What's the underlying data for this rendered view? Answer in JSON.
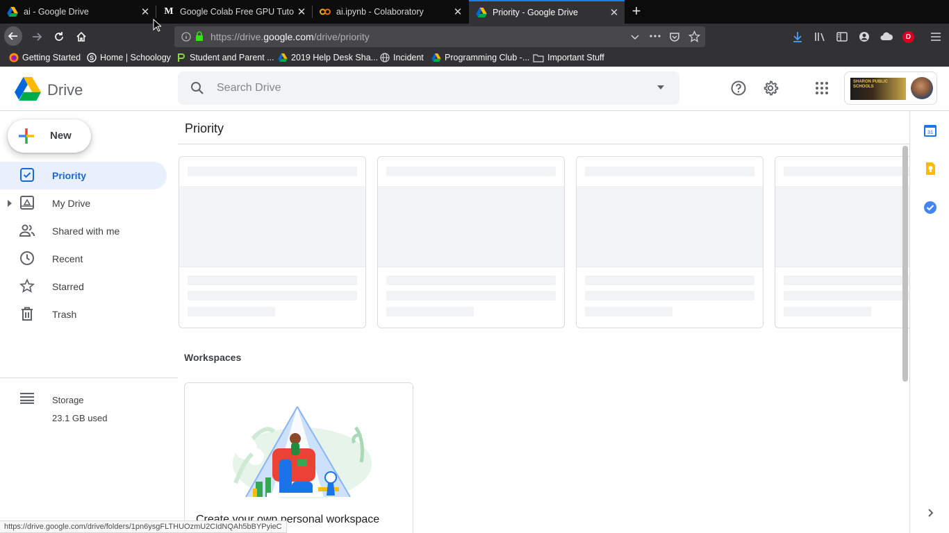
{
  "browser": {
    "tabs": [
      {
        "title": "ai - Google Drive",
        "favicon": "google-drive-icon"
      },
      {
        "title": "Google Colab Free GPU Tutoria",
        "favicon": "medium-icon"
      },
      {
        "title": "ai.ipynb - Colaboratory",
        "favicon": "colab-icon"
      },
      {
        "title": "Priority - Google Drive",
        "favicon": "google-drive-icon",
        "active": true
      }
    ],
    "close_glyph": "✕",
    "newtab_glyph": "+",
    "url": {
      "prefix": "https://drive.",
      "domain": "google.com",
      "path": "/drive/priority"
    },
    "profile_initial": "D",
    "bookmarks": [
      {
        "label": "Getting Started",
        "icon": "firefox-icon"
      },
      {
        "label": "Home | Schoology",
        "icon": "schoology-icon"
      },
      {
        "label": "Student and Parent ...",
        "icon": "bookmark-p-icon"
      },
      {
        "label": "2019 Help Desk Sha...",
        "icon": "google-drive-icon"
      },
      {
        "label": "Incident",
        "icon": "globe-icon"
      },
      {
        "label": "Programming Club -...",
        "icon": "google-drive-icon"
      },
      {
        "label": "Important Stuff",
        "icon": "folder-icon"
      }
    ],
    "status_url": "https://drive.google.com/drive/folders/1pn6ysgFLTHUOzmU2CIdNQAh5bBYPyieC"
  },
  "app": {
    "name": "Drive",
    "search_placeholder": "Search Drive",
    "account_logo_text": "SHARON PUBLIC SCHOOLS",
    "new_label": "New",
    "nav": [
      {
        "label": "Priority",
        "icon": "priority-check-icon",
        "active": true
      },
      {
        "label": "My Drive",
        "icon": "my-drive-icon",
        "expandable": true
      },
      {
        "label": "Shared with me",
        "icon": "shared-people-icon"
      },
      {
        "label": "Recent",
        "icon": "clock-icon"
      },
      {
        "label": "Starred",
        "icon": "star-icon"
      },
      {
        "label": "Trash",
        "icon": "trash-icon"
      }
    ],
    "storage": {
      "label": "Storage",
      "used": "23.1 GB used"
    },
    "page_title": "Priority",
    "workspaces_title": "Workspaces",
    "workspace_card_caption": "Create your own personal workspace",
    "calendar_day": "31",
    "colors": {
      "accent": "#1a73e8",
      "active_bg": "#e8f0fe",
      "active_text": "#1967d2",
      "tab_accent": "#0a84ff"
    }
  }
}
